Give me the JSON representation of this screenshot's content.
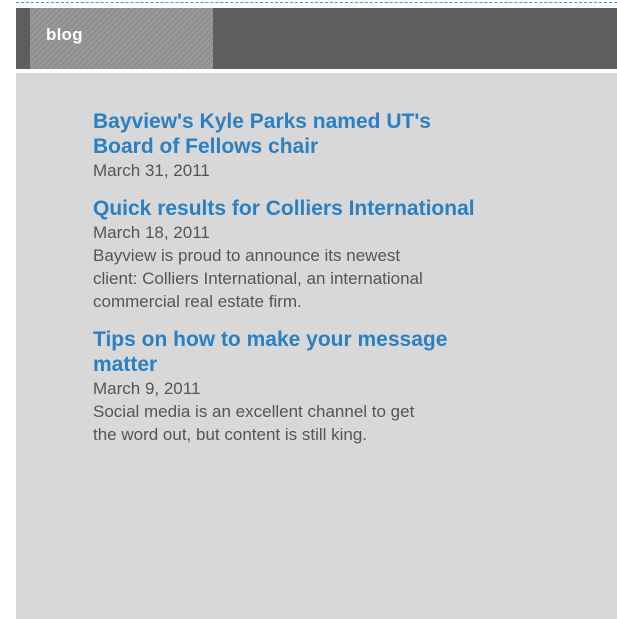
{
  "widget": {
    "tab_label": "blog"
  },
  "posts": [
    {
      "title_line1": "Bayview's Kyle Parks named UT's",
      "title_line2": "Board of Fellows chair",
      "date": "March 31, 2011",
      "excerpt_line1": "",
      "excerpt_line2": "",
      "excerpt_line3": ""
    },
    {
      "title_line1": "Quick results for Colliers International",
      "title_line2": "",
      "date": "March 18, 2011",
      "excerpt_line1": "Bayview is proud to announce its newest",
      "excerpt_line2": "client: Colliers International, an international",
      "excerpt_line3": "commercial real estate firm."
    },
    {
      "title_line1": "Tips on how to make your message",
      "title_line2": "matter",
      "date": "March 9, 2011",
      "excerpt_line1": "Social media is an excellent channel to get",
      "excerpt_line2": "the word out, but content is still king.",
      "excerpt_line3": ""
    }
  ],
  "colors": {
    "accent_link": "#2b7fc3",
    "header_bg": "#5e5e5e",
    "panel_bg": "#d8d8d8",
    "text_muted": "#555555"
  }
}
